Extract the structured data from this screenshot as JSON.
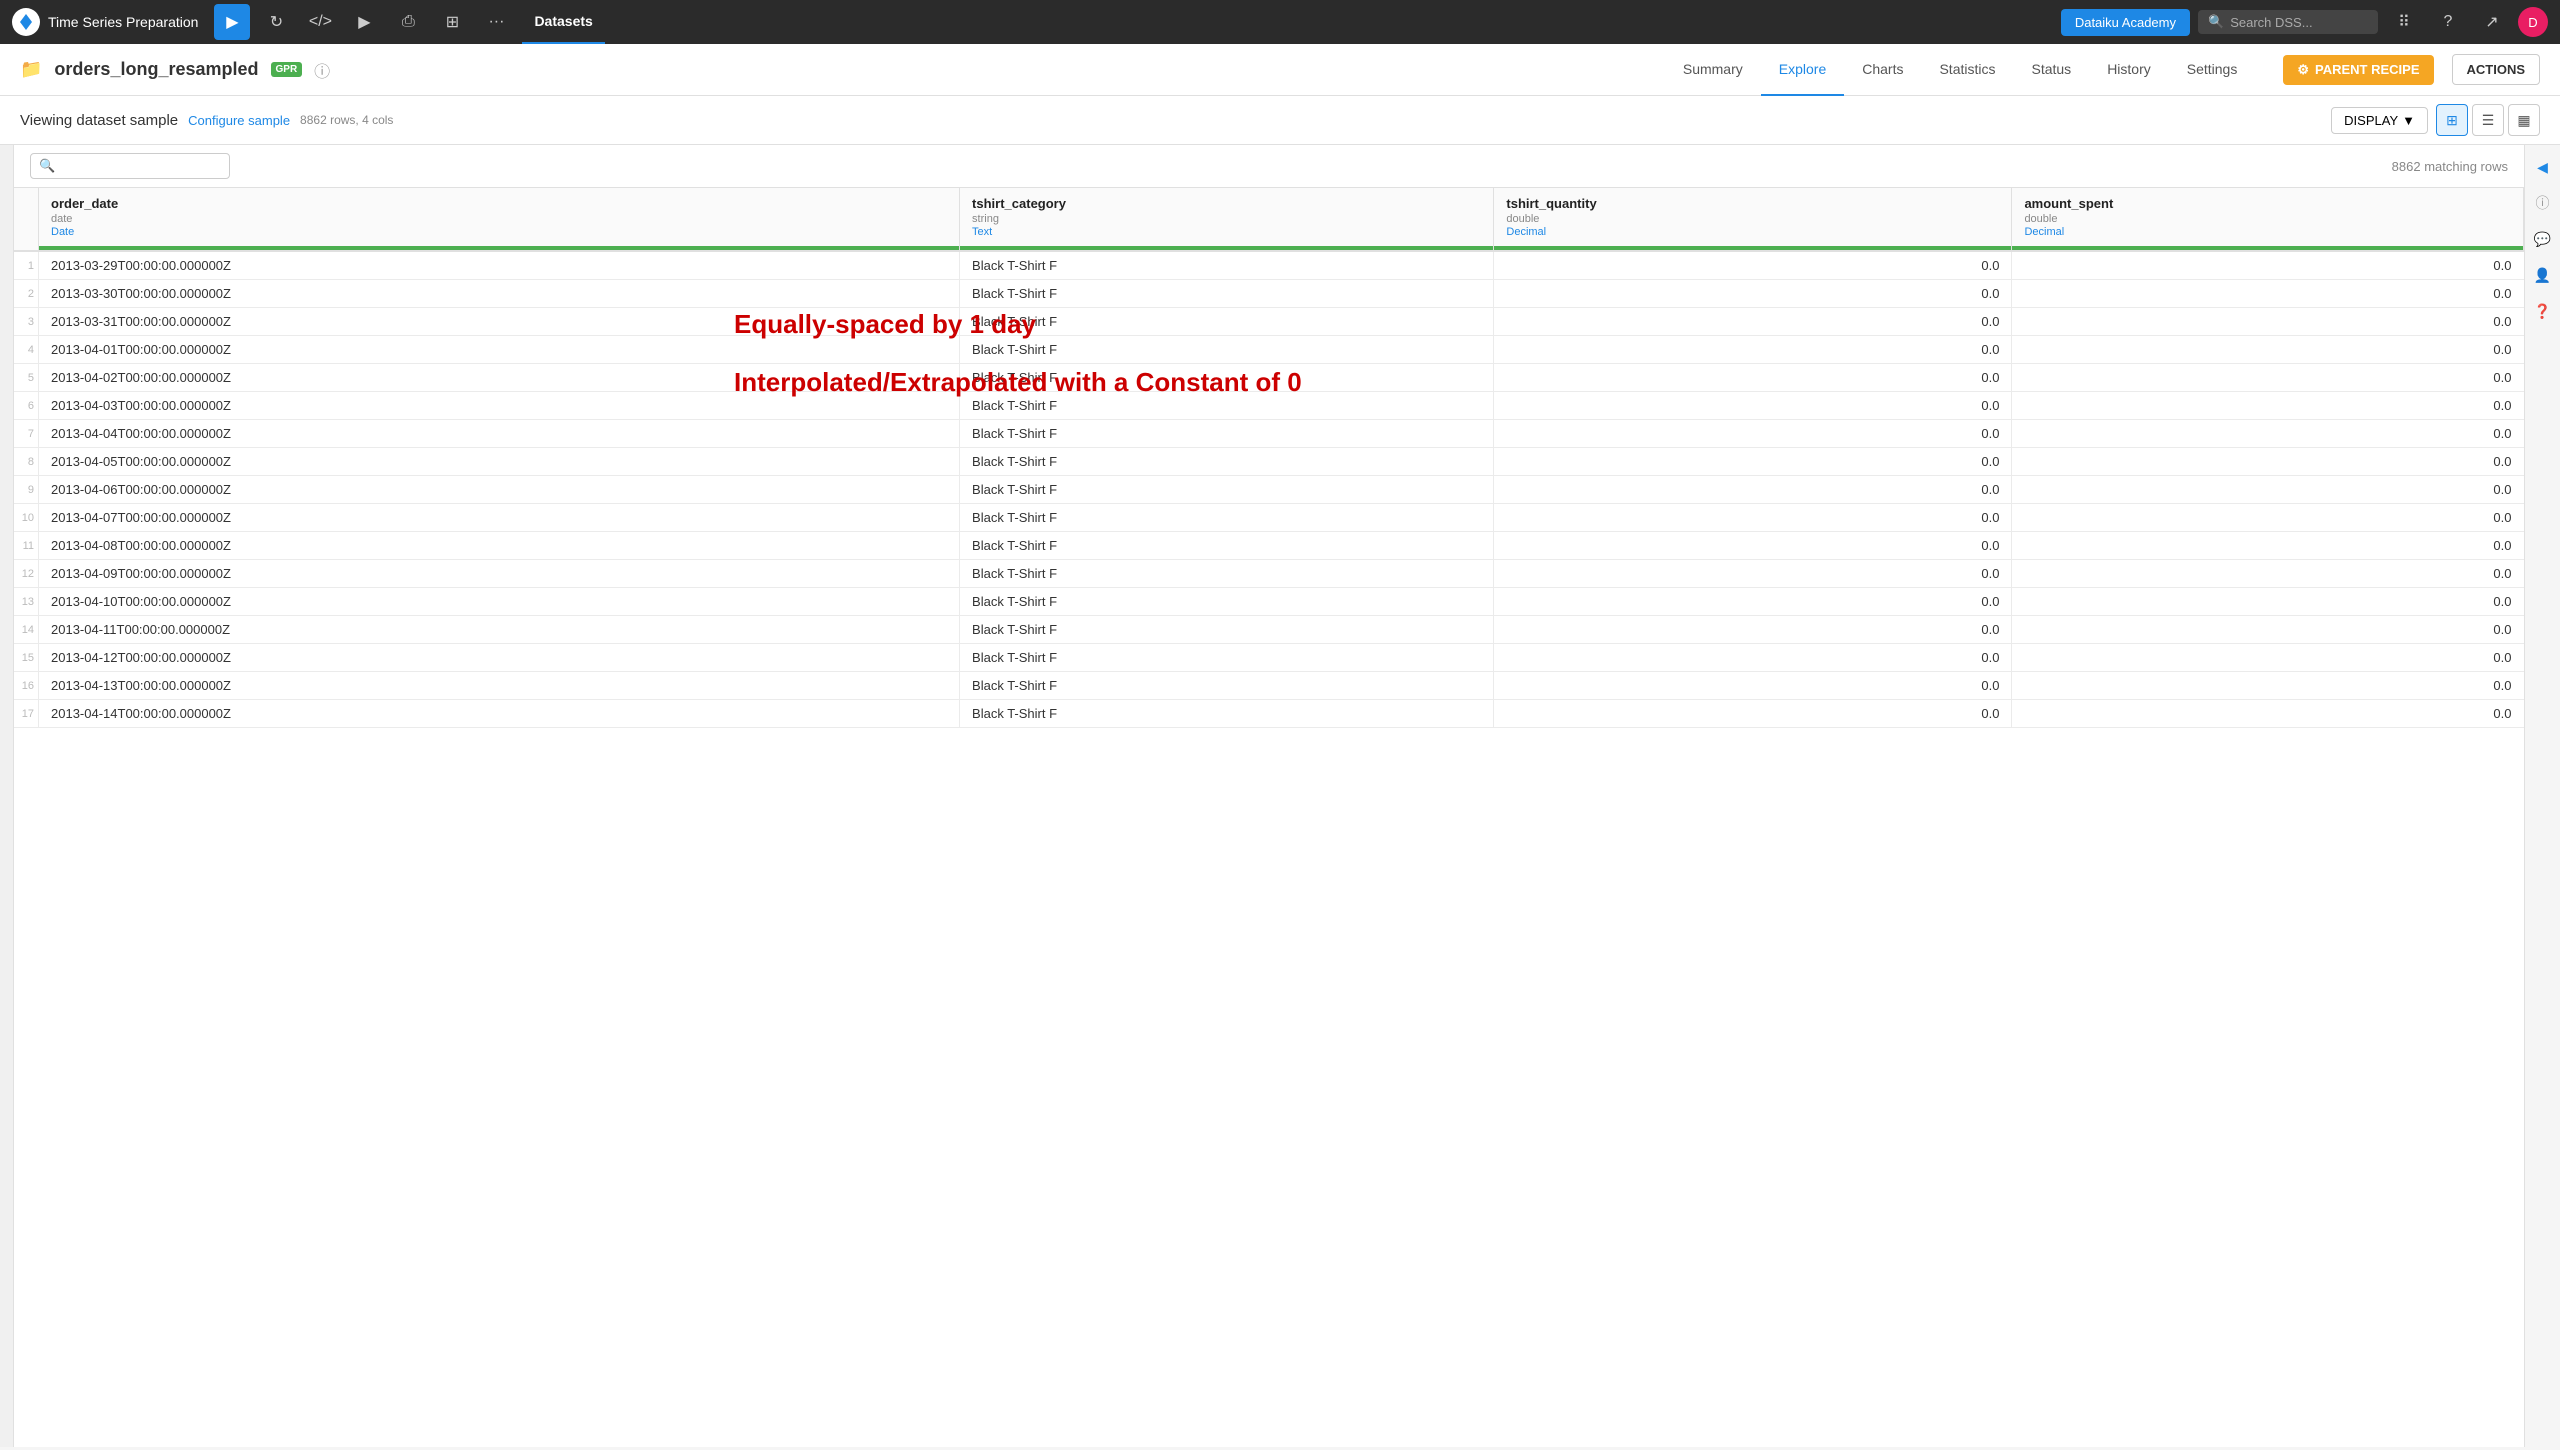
{
  "app": {
    "title": "Time Series Preparation",
    "active_section": "Datasets"
  },
  "topbar": {
    "app_name": "Time Series Preparation",
    "workspace": "Dataiku Academy",
    "search_placeholder": "Search DSS...",
    "icons": [
      "flow",
      "git",
      "run",
      "deploy",
      "settings",
      "more"
    ]
  },
  "header": {
    "dataset_name": "orders_long_resampled",
    "badge": "GPR",
    "tabs": [
      {
        "id": "summary",
        "label": "Summary",
        "active": false
      },
      {
        "id": "explore",
        "label": "Explore",
        "active": true
      },
      {
        "id": "charts",
        "label": "Charts",
        "active": false
      },
      {
        "id": "statistics",
        "label": "Statistics",
        "active": false
      },
      {
        "id": "status",
        "label": "Status",
        "active": false
      },
      {
        "id": "history",
        "label": "History",
        "active": false
      },
      {
        "id": "settings",
        "label": "Settings",
        "active": false
      }
    ],
    "btn_parent_recipe": "PARENT RECIPE",
    "btn_actions": "ACTIONS"
  },
  "subheader": {
    "title": "Viewing dataset sample",
    "configure_link": "Configure sample",
    "meta": "8862 rows,  4 cols",
    "display_btn": "DISPLAY",
    "matching_rows": "8862 matching rows"
  },
  "columns": [
    {
      "name": "order_date",
      "type": "date",
      "meaning": "Date",
      "meaning_color": "blue",
      "indicator_class": "date-col"
    },
    {
      "name": "tshirt_category",
      "type": "string",
      "meaning": "Text",
      "meaning_color": "blue",
      "indicator_class": "text-col"
    },
    {
      "name": "tshirt_quantity",
      "type": "double",
      "meaning": "Decimal",
      "meaning_color": "blue",
      "indicator_class": "decimal-col"
    },
    {
      "name": "amount_spent",
      "type": "double",
      "meaning": "Decimal",
      "meaning_color": "blue",
      "indicator_class": "decimal-col"
    }
  ],
  "rows": [
    {
      "date": "2013-03-29T00:00:00.000000Z",
      "category": "Black T-Shirt F",
      "quantity": "0.0",
      "amount": "0.0"
    },
    {
      "date": "2013-03-30T00:00:00.000000Z",
      "category": "Black T-Shirt F",
      "quantity": "0.0",
      "amount": "0.0"
    },
    {
      "date": "2013-03-31T00:00:00.000000Z",
      "category": "Black T-Shirt F",
      "quantity": "0.0",
      "amount": "0.0"
    },
    {
      "date": "2013-04-01T00:00:00.000000Z",
      "category": "Black T-Shirt F",
      "quantity": "0.0",
      "amount": "0.0"
    },
    {
      "date": "2013-04-02T00:00:00.000000Z",
      "category": "Black T-Shirt F",
      "quantity": "0.0",
      "amount": "0.0"
    },
    {
      "date": "2013-04-03T00:00:00.000000Z",
      "category": "Black T-Shirt F",
      "quantity": "0.0",
      "amount": "0.0"
    },
    {
      "date": "2013-04-04T00:00:00.000000Z",
      "category": "Black T-Shirt F",
      "quantity": "0.0",
      "amount": "0.0"
    },
    {
      "date": "2013-04-05T00:00:00.000000Z",
      "category": "Black T-Shirt F",
      "quantity": "0.0",
      "amount": "0.0"
    },
    {
      "date": "2013-04-06T00:00:00.000000Z",
      "category": "Black T-Shirt F",
      "quantity": "0.0",
      "amount": "0.0"
    },
    {
      "date": "2013-04-07T00:00:00.000000Z",
      "category": "Black T-Shirt F",
      "quantity": "0.0",
      "amount": "0.0"
    },
    {
      "date": "2013-04-08T00:00:00.000000Z",
      "category": "Black T-Shirt F",
      "quantity": "0.0",
      "amount": "0.0"
    },
    {
      "date": "2013-04-09T00:00:00.000000Z",
      "category": "Black T-Shirt F",
      "quantity": "0.0",
      "amount": "0.0"
    },
    {
      "date": "2013-04-10T00:00:00.000000Z",
      "category": "Black T-Shirt F",
      "quantity": "0.0",
      "amount": "0.0"
    },
    {
      "date": "2013-04-11T00:00:00.000000Z",
      "category": "Black T-Shirt F",
      "quantity": "0.0",
      "amount": "0.0"
    },
    {
      "date": "2013-04-12T00:00:00.000000Z",
      "category": "Black T-Shirt F",
      "quantity": "0.0",
      "amount": "0.0"
    },
    {
      "date": "2013-04-13T00:00:00.000000Z",
      "category": "Black T-Shirt F",
      "quantity": "0.0",
      "amount": "0.0"
    },
    {
      "date": "2013-04-14T00:00:00.000000Z",
      "category": "Black T-Shirt F",
      "quantity": "0.0",
      "amount": "0.0"
    }
  ],
  "annotations": {
    "line1": "Equally-spaced by 1 day",
    "line2": "Interpolated/Extrapolated with a Constant of 0"
  }
}
